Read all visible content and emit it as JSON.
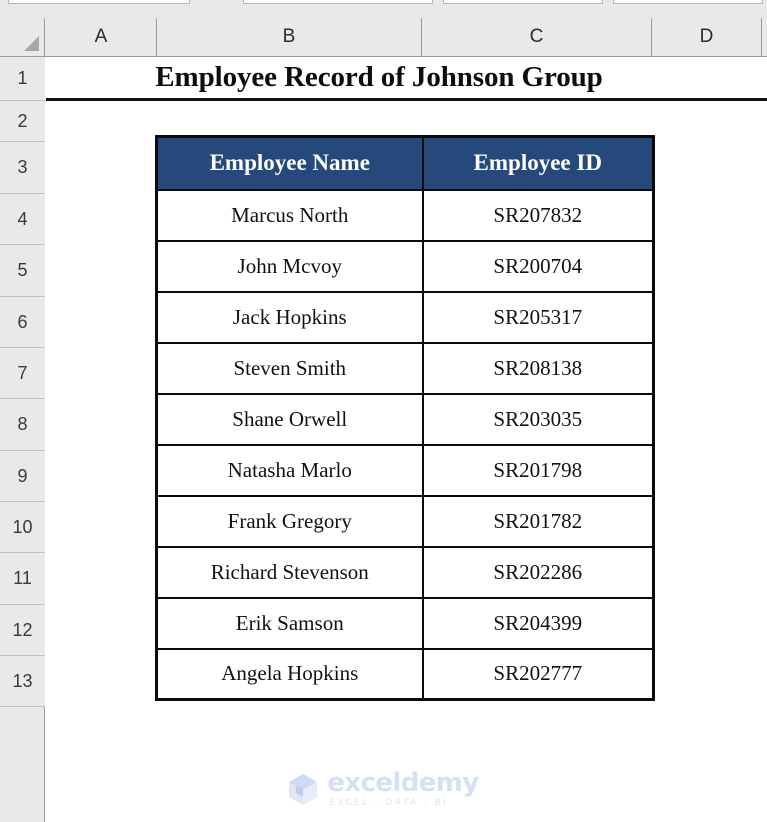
{
  "app": {
    "type": "spreadsheet",
    "theme": {
      "header_fill": "#24497A",
      "header_text": "#FFFFFF",
      "grid_chrome": "#E9E9E9",
      "border": "#0A0A0A",
      "watermark": "#D6E0F5"
    }
  },
  "formula_bar": {
    "boxes": [
      "",
      "",
      "",
      ""
    ]
  },
  "columns": {
    "select_all": "select-all-triangle",
    "headers": [
      "A",
      "B",
      "C",
      "D"
    ]
  },
  "rows": {
    "headers": [
      "1",
      "2",
      "3",
      "4",
      "5",
      "6",
      "7",
      "8",
      "9",
      "10",
      "11",
      "12",
      "13"
    ]
  },
  "sheet": {
    "title": "Employee Record of Johnson Group"
  },
  "table": {
    "columns": [
      "Employee Name",
      "Employee ID"
    ],
    "rows": [
      {
        "name": "Marcus North",
        "id": "SR207832"
      },
      {
        "name": "John Mcvoy",
        "id": "SR200704"
      },
      {
        "name": "Jack Hopkins",
        "id": "SR205317"
      },
      {
        "name": "Steven Smith",
        "id": "SR208138"
      },
      {
        "name": "Shane Orwell",
        "id": "SR203035"
      },
      {
        "name": "Natasha Marlo",
        "id": "SR201798"
      },
      {
        "name": "Frank Gregory",
        "id": "SR201782"
      },
      {
        "name": "Richard Stevenson",
        "id": "SR202286"
      },
      {
        "name": "Erik Samson",
        "id": "SR204399"
      },
      {
        "name": "Angela Hopkins",
        "id": "SR202777"
      }
    ]
  },
  "watermark": {
    "logo": "exceldemy-cube-logo",
    "name": "exceldemy",
    "tagline": "EXCEL - DATA - BI"
  }
}
